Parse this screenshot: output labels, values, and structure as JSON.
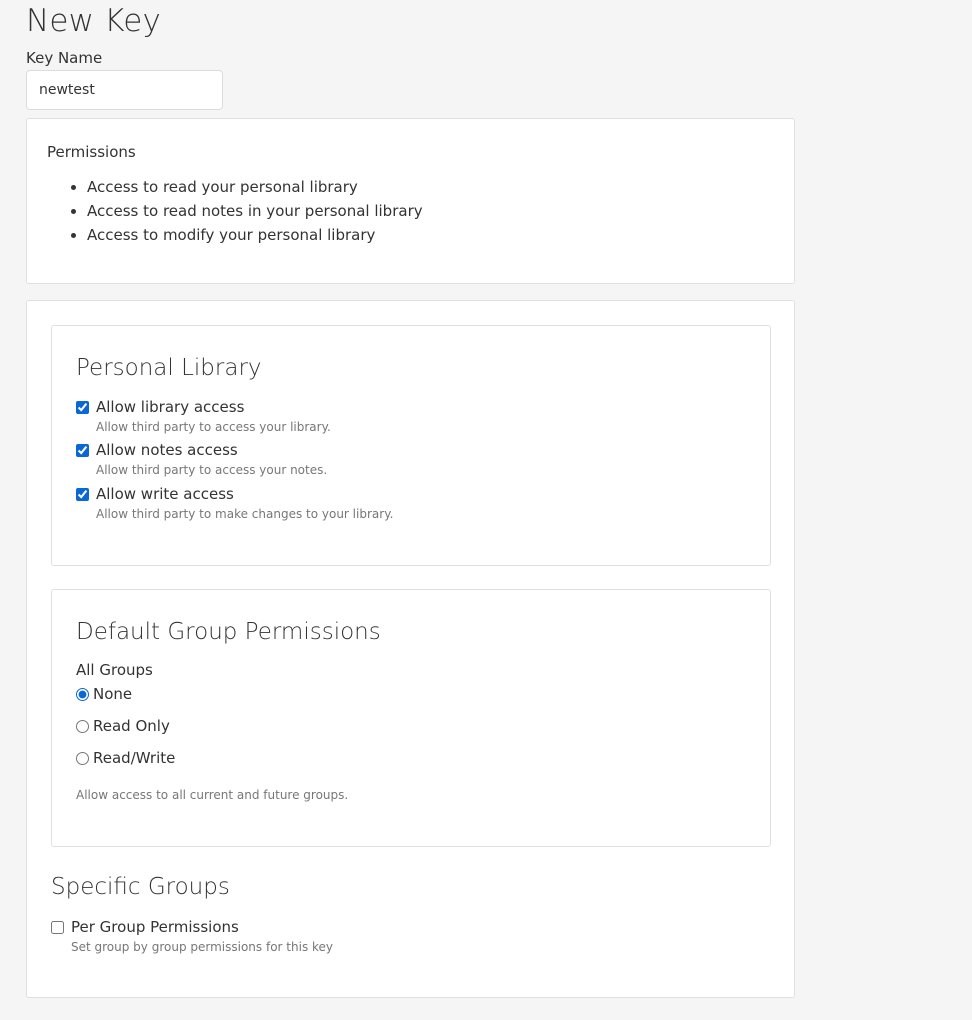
{
  "page": {
    "title": "New Key"
  },
  "key_name": {
    "label": "Key Name",
    "value": "newtest"
  },
  "summary": {
    "title": "Permissions",
    "items": [
      "Access to read your personal library",
      "Access to read notes in your personal library",
      "Access to modify your personal library"
    ]
  },
  "personal_library": {
    "heading": "Personal Library",
    "options": [
      {
        "label": "Allow library access",
        "help": "Allow third party to access your library.",
        "checked": true
      },
      {
        "label": "Allow notes access",
        "help": "Allow third party to access your notes.",
        "checked": true
      },
      {
        "label": "Allow write access",
        "help": "Allow third party to make changes to your library.",
        "checked": true
      }
    ]
  },
  "default_group": {
    "heading": "Default Group Permissions",
    "group_label": "All Groups",
    "options": [
      {
        "label": "None",
        "selected": true
      },
      {
        "label": "Read Only",
        "selected": false
      },
      {
        "label": "Read/Write",
        "selected": false
      }
    ],
    "help": "Allow access to all current and future groups."
  },
  "specific_groups": {
    "heading": "Specific Groups",
    "option_label": "Per Group Permissions",
    "option_checked": false,
    "help": "Set group by group permissions for this key"
  },
  "colors": {
    "accent": "#0a67d6",
    "background": "#f5f5f5",
    "card": "#ffffff",
    "border": "#e0e0e0"
  }
}
